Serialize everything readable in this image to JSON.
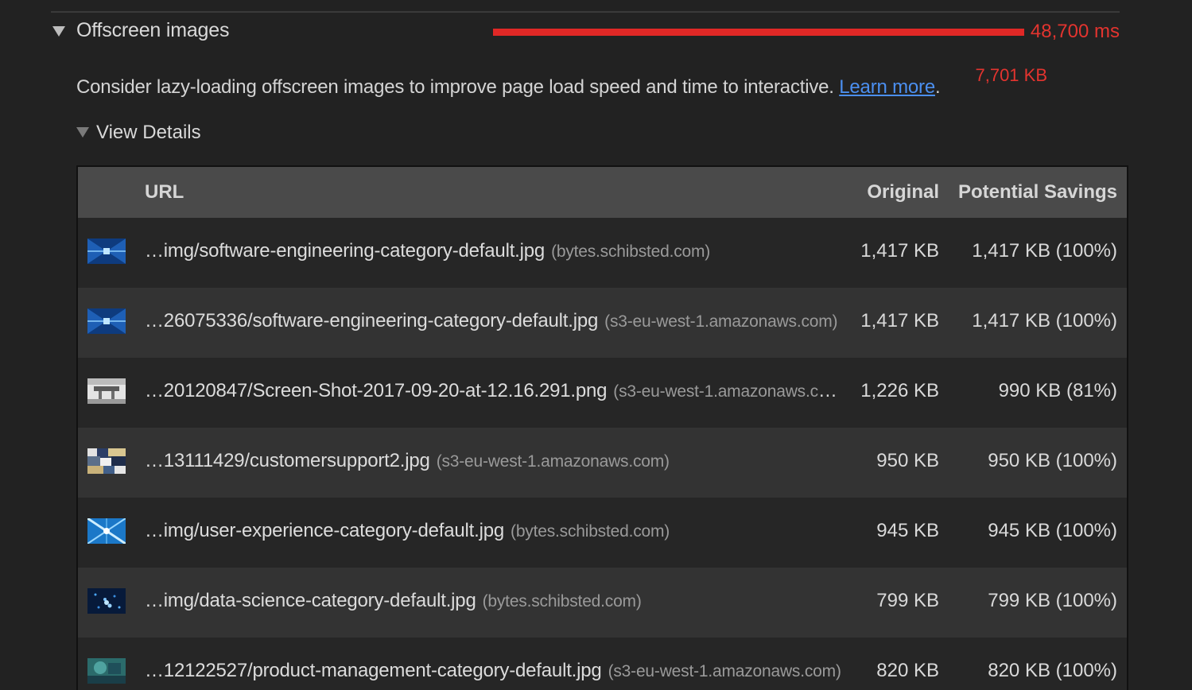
{
  "audit": {
    "title": "Offscreen images",
    "savings_ms": "48,700 ms",
    "savings_kb": "7,701 KB",
    "description": "Consider lazy-loading offscreen images to improve page load speed and time to interactive.",
    "learn_more": "Learn more",
    "description_end": "."
  },
  "details": {
    "label": "View Details"
  },
  "table": {
    "headers": {
      "url": "URL",
      "original": "Original",
      "savings": "Potential Savings"
    },
    "rows": [
      {
        "path": "…img/software-engineering-category-default.jpg",
        "host": "(bytes.schibsted.com)",
        "original": "1,417 KB",
        "savings": "1,417 KB (100%)",
        "thumb": "blue-tunnel"
      },
      {
        "path": "…26075336/software-engineering-category-default.jpg",
        "host": "(s3-eu-west-1.amazonaws.com)",
        "original": "1,417 KB",
        "savings": "1,417 KB (100%)",
        "thumb": "blue-tunnel"
      },
      {
        "path": "…20120847/Screen-Shot-2017-09-20-at-12.16.291.png",
        "host": "(s3-eu-west-1.amazonaws.com)",
        "original": "1,226 KB",
        "savings": "990 KB (81%)",
        "thumb": "gray-screenshot"
      },
      {
        "path": "…13111429/customersupport2.jpg",
        "host": "(s3-eu-west-1.amazonaws.com)",
        "original": "950 KB",
        "savings": "950 KB (100%)",
        "thumb": "collage"
      },
      {
        "path": "…img/user-experience-category-default.jpg",
        "host": "(bytes.schibsted.com)",
        "original": "945 KB",
        "savings": "945 KB (100%)",
        "thumb": "blue-burst"
      },
      {
        "path": "…img/data-science-category-default.jpg",
        "host": "(bytes.schibsted.com)",
        "original": "799 KB",
        "savings": "799 KB (100%)",
        "thumb": "dark-blue-dots"
      },
      {
        "path": "…12122527/product-management-category-default.jpg",
        "host": "(s3-eu-west-1.amazonaws.com)",
        "original": "820 KB",
        "savings": "820 KB (100%)",
        "thumb": "teal-abstract"
      }
    ]
  },
  "colors": {
    "background": "#222222",
    "accent_red": "#e3342f",
    "link_blue": "#4b8ff0",
    "header_bg": "#4a4a4a"
  }
}
